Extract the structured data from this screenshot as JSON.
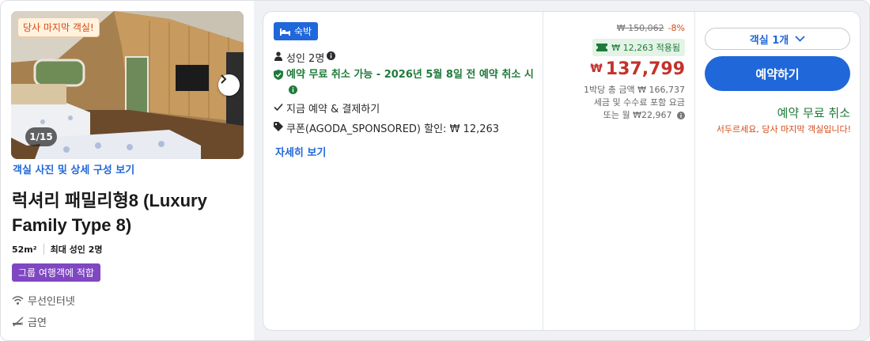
{
  "room": {
    "last_room_badge": "당사 마지막 객실!",
    "photo_counter": "1/15",
    "view_photos_link": "객실 사진 및 상세 구성 보기",
    "title": "럭셔리 패밀리형8 (Luxury Family Type 8)",
    "size": "52m²",
    "max_occupancy": "최대 성인 2명",
    "group_badge": "그룹 여행객에 적합",
    "amenities": [
      {
        "icon": "wifi-icon",
        "label": "무선인터넷"
      },
      {
        "icon": "no-smoking-icon",
        "label": "금연"
      }
    ]
  },
  "offer": {
    "stay_badge": "숙박",
    "adults": "성인 2명",
    "free_cancel_text": "예약 무료 취소 가능 - 2026년 5월 8일 전 예약 취소 시",
    "pay_now": "지금 예약 & 결제하기",
    "coupon": "쿠폰(AGODA_SPONSORED) 할인: ₩ 12,263",
    "details_link": "자세히 보기"
  },
  "price": {
    "original": "₩ 150,062",
    "discount_pct": "-8%",
    "coupon_applied": "₩ 12,263 적용됨",
    "currency": "₩",
    "amount": "137,799",
    "per_night_total": "1박당 총 금액 ₩ 166,737",
    "tax_note": "세금 및 수수료 포함 요금",
    "monthly": "또는 월 ₩22,967"
  },
  "actions": {
    "room_count": "객실 1개",
    "book_button": "예약하기",
    "free_cancel": "예약 무료 취소",
    "hurry": "서두르세요, 당사 마지막 객실입니다!"
  },
  "colors": {
    "accent_blue": "#2067da",
    "price_red": "#c3322c",
    "green": "#1f7a3a",
    "orange": "#d44a14",
    "purple": "#7f47c2"
  }
}
